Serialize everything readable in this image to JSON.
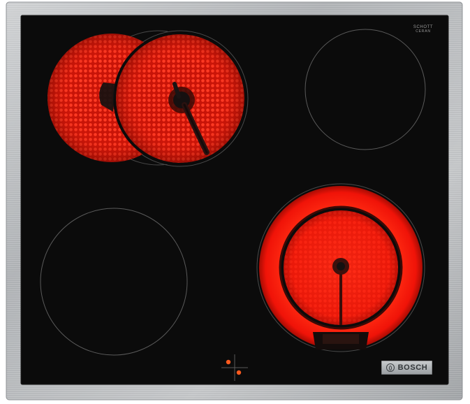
{
  "cooktop": {
    "brand": "BOSCH",
    "glass_logo_line1": "SCHOTT",
    "glass_logo_line2": "CERAN",
    "glass_logo_line3": "",
    "serial_mark": "",
    "frame_color": "#b9bcbf",
    "glass_color": "#0b0b0b",
    "glow_color": "#ff1a0a"
  },
  "zones": [
    {
      "name": "rear-left dual-circuit zone",
      "state": "on"
    },
    {
      "name": "rear-right zone",
      "state": "off"
    },
    {
      "name": "front-left zone",
      "state": "off"
    },
    {
      "name": "front-right dual-ring zone",
      "state": "on"
    }
  ],
  "indicators": [
    {
      "name": "residual-heat indicator",
      "state": "on"
    },
    {
      "name": "residual-heat indicator",
      "state": "on"
    }
  ]
}
